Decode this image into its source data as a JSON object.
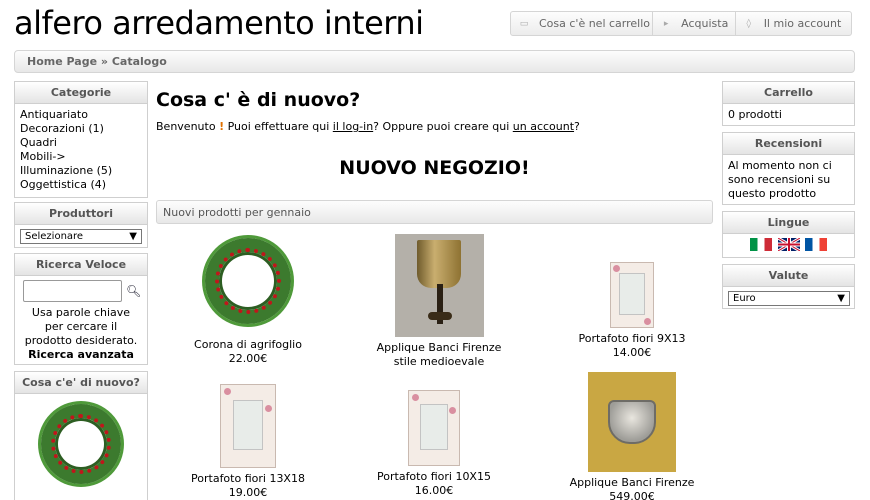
{
  "header": {
    "logo": "alfero arredamento interni",
    "nav": [
      {
        "label": "Cosa c'è nel carrello",
        "icon": "cart-icon"
      },
      {
        "label": "Acquista",
        "icon": "arrow-right-icon"
      },
      {
        "label": "Il mio account",
        "icon": "account-icon"
      }
    ]
  },
  "breadcrumb": {
    "home": "Home Page",
    "sep": "»",
    "current": "Catalogo"
  },
  "left": {
    "categories": {
      "title": "Categorie",
      "items": [
        "Antiquariato",
        "Decorazioni (1)",
        "Quadri",
        "Mobili->",
        "Illuminazione (5)",
        "Oggettistica (4)"
      ]
    },
    "manufacturers": {
      "title": "Produttori",
      "selected": "Selezionare"
    },
    "quick_search": {
      "title": "Ricerca Veloce",
      "hint": "Usa parole chiave per cercare il prodotto desiderato.",
      "advanced": "Ricerca avanzata"
    },
    "whats_new": {
      "title": "Cosa c'e' di nuovo?"
    }
  },
  "main": {
    "title": "Cosa c' è di nuovo?",
    "welcome_pre": "Benvenuto",
    "welcome_ex": "!",
    "welcome_mid": "Puoi effettuare qui",
    "login_link": "il log-in",
    "welcome_mid2": "? Oppure puoi creare qui",
    "account_link": "un account",
    "welcome_end": "?",
    "new_shop": "NUOVO NEGOZIO!",
    "new_products_title": "Nuovi prodotti per gennaio",
    "products": [
      {
        "name": "Corona di agrifoglio",
        "price": "22.00€"
      },
      {
        "name": "Applique Banci Firenze stile medioevale",
        "price": ""
      },
      {
        "name": "Portafoto fiori 9X13",
        "price": "14.00€"
      },
      {
        "name": "Portafoto fiori 13X18",
        "price": "19.00€"
      },
      {
        "name": "Portafoto fiori 10X15",
        "price": "16.00€"
      },
      {
        "name": "Applique Banci Firenze",
        "price": "549.00€"
      }
    ]
  },
  "right": {
    "cart": {
      "title": "Carrello",
      "text": "0 prodotti"
    },
    "reviews": {
      "title": "Recensioni",
      "text": "Al momento non ci sono recensioni su questo prodotto"
    },
    "languages": {
      "title": "Lingue"
    },
    "currency": {
      "title": "Valute",
      "selected": "Euro"
    }
  }
}
